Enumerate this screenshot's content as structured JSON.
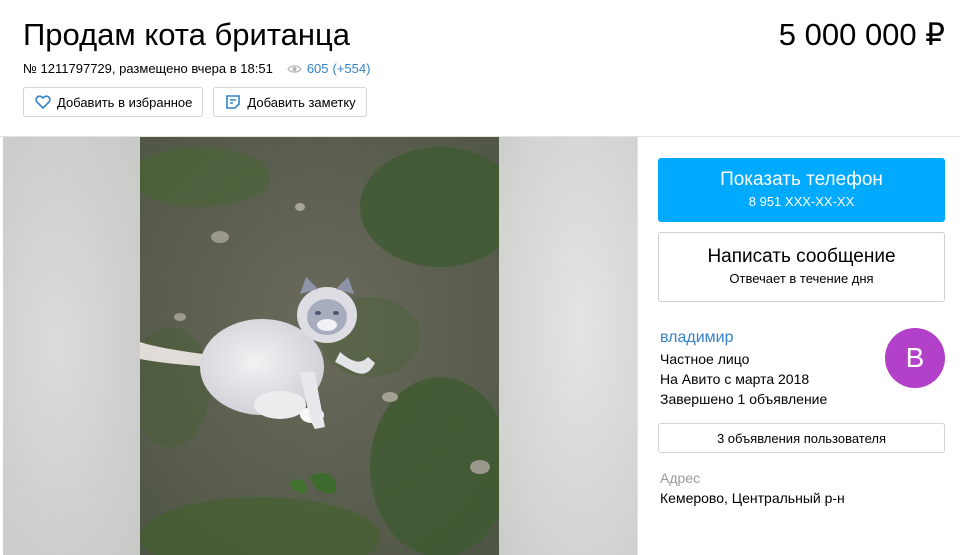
{
  "listing": {
    "title": "Продам кота британца",
    "price": "5 000 000 ₽",
    "number_posted": "№ 1211797729, размещено вчера в 18:51",
    "views": "605",
    "views_new": "(+554)"
  },
  "actions": {
    "favorite_label": "Добавить в избранное",
    "note_label": "Добавить заметку"
  },
  "contact": {
    "phone_button_label": "Показать телефон",
    "phone_masked": "8 951 XXX-XX-XX",
    "message_button_label": "Написать сообщение",
    "message_response": "Отвечает в течение дня"
  },
  "seller": {
    "name": "владимир",
    "type": "Частное лицо",
    "since": "На Авито с марта 2018",
    "completed": "Завершено 1 объявление",
    "avatar_letter": "В",
    "avatar_color": "#b340c9",
    "ads_button_label": "3 объявления пользователя"
  },
  "address": {
    "label": "Адрес",
    "value": "Кемерово, Центральный р-н"
  },
  "colors": {
    "accent_blue": "#00aaff",
    "link_blue": "#3483c8"
  },
  "icons": [
    "eye-icon",
    "heart-icon",
    "note-icon"
  ]
}
